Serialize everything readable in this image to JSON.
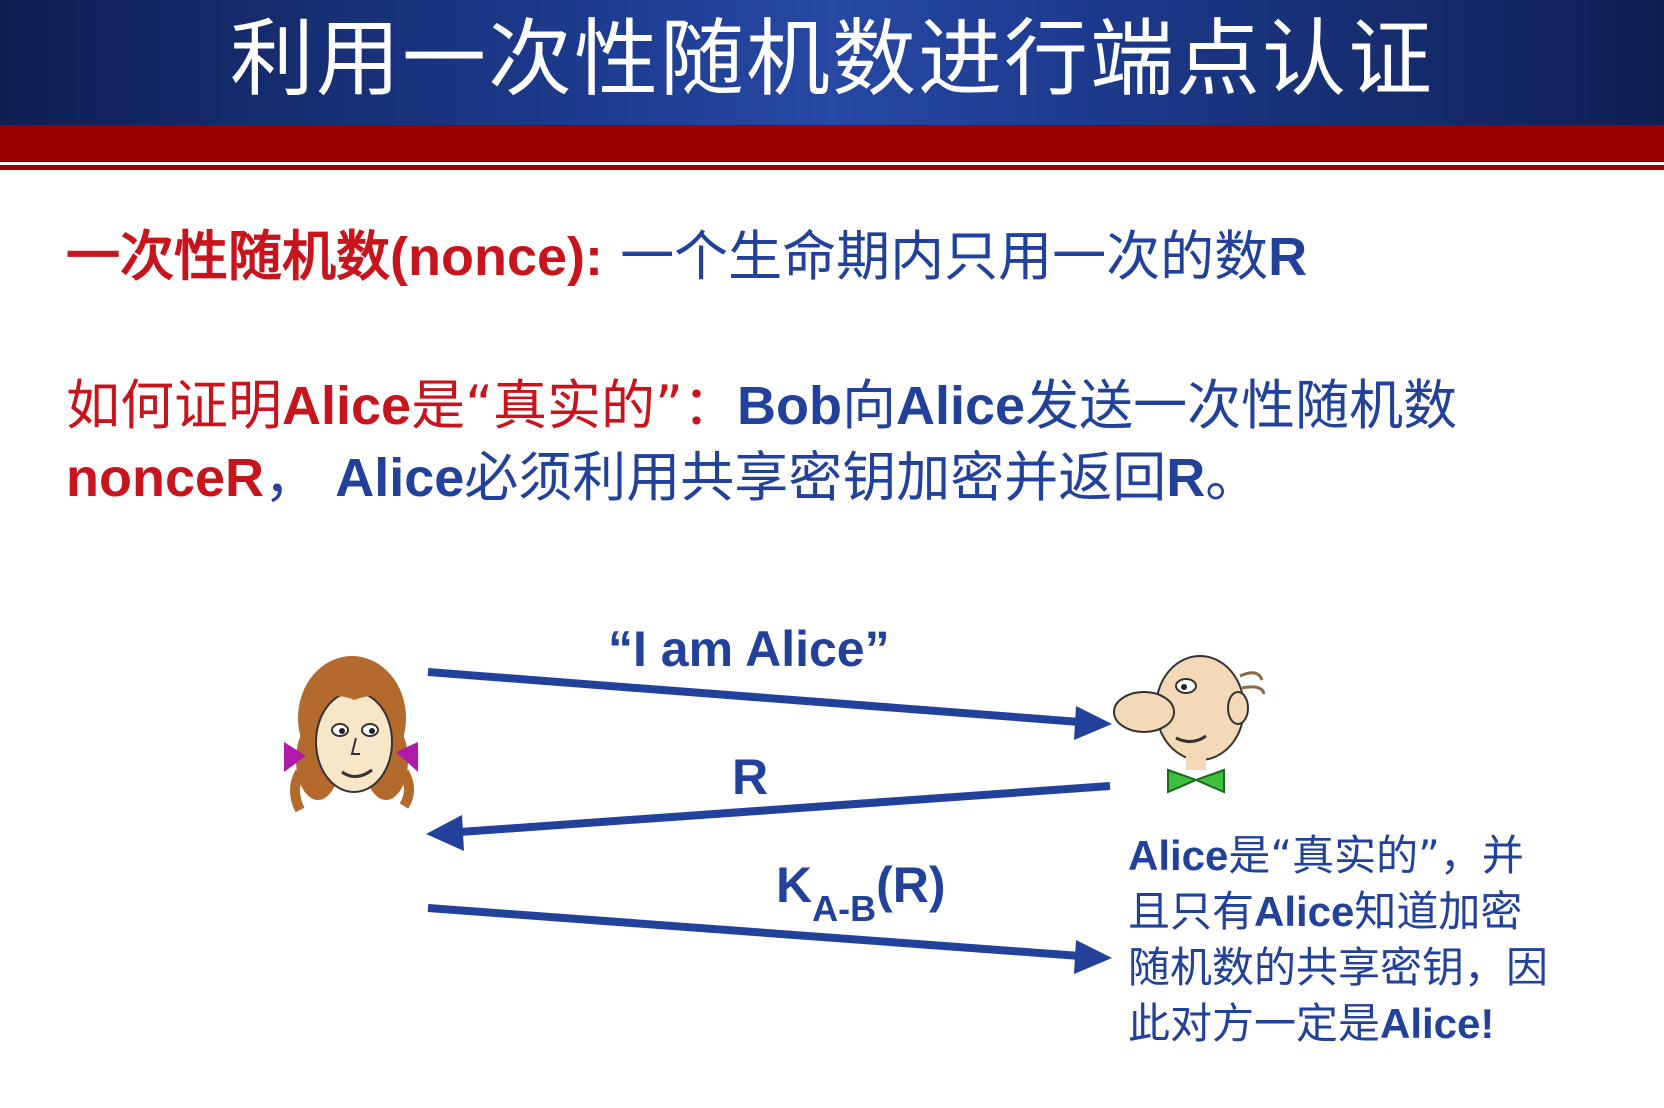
{
  "title": "利用一次性随机数进行端点认证",
  "definition": {
    "term": "一次性随机数(nonce):",
    "text": "一个生命期内只用一次的数",
    "symbol": "R"
  },
  "question": {
    "q1": "如何证明",
    "q_alice": "Alice",
    "q2": "是“真实的”：",
    "a_bob": "Bob",
    "a1": "向",
    "a_alice1": "Alice",
    "a2": "发送一次性随机数",
    "a_nonce": "nonceR",
    "a3": "，",
    "a_alice2": "Alice",
    "a4": "必须利用共享密钥加密并返回",
    "a_r": "R",
    "a5": "。"
  },
  "diagram": {
    "msg1": "“I am Alice”",
    "msg2": "R",
    "msg3_k": "K",
    "msg3_sub": "A-B",
    "msg3_r": "(R)",
    "arrow_color": "#22419a"
  },
  "note": {
    "alice1": "Alice",
    "t1": "是“真实的”，并且只有",
    "alice2": "Alice",
    "t2": "知道加密随机数的共享密钥，因此对方一定是",
    "alice3": "Alice!"
  },
  "colors": {
    "header": "#1e3d93",
    "redbar": "#9b0000",
    "red": "#c8151d",
    "blue": "#22419a"
  }
}
